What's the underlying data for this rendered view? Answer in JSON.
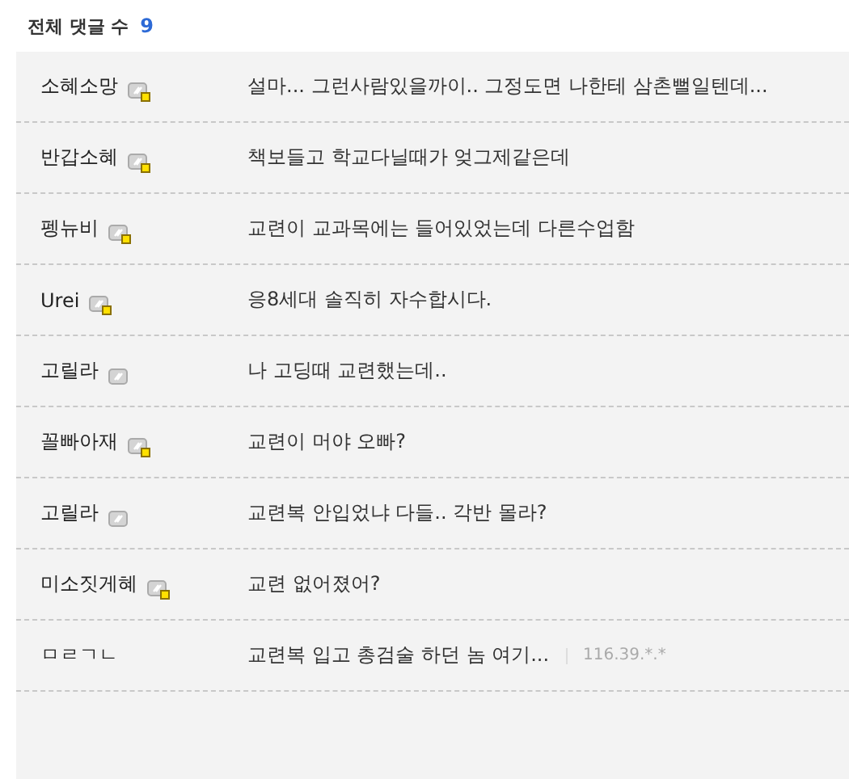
{
  "header": {
    "label": "전체 댓글 수",
    "count": "9"
  },
  "comments": [
    {
      "author": "소혜소망",
      "kind": "verified",
      "text": "설마... 그런사람있을까이.. 그정도면 나한테 삼촌뻘일텐데..."
    },
    {
      "author": "반갑소혜",
      "kind": "verified",
      "text": "책보들고 학교다닐때가 엊그제같은데"
    },
    {
      "author": "펭뉴비",
      "kind": "verified",
      "text": "교련이 교과목에는 들어있었는데 다른수업함"
    },
    {
      "author": "Urei",
      "kind": "verified",
      "text": "응8세대 솔직히 자수합시다."
    },
    {
      "author": "고릴라",
      "kind": "member",
      "text": "나 고딩때 교련했는데.."
    },
    {
      "author": "꼴빠아재",
      "kind": "verified",
      "text": "교련이 머야 오빠?"
    },
    {
      "author": "고릴라",
      "kind": "member",
      "text": "교련복 안입었냐 다들.. 각반 몰라?"
    },
    {
      "author": "미소짓게혜",
      "kind": "verified",
      "text": "교련 없어졌어?"
    },
    {
      "author": "ㅁㄹㄱㄴ",
      "kind": "guest",
      "text": "교련복 입고 총검술 하던 놈 여기...",
      "ip": "116.39.*.*"
    }
  ]
}
